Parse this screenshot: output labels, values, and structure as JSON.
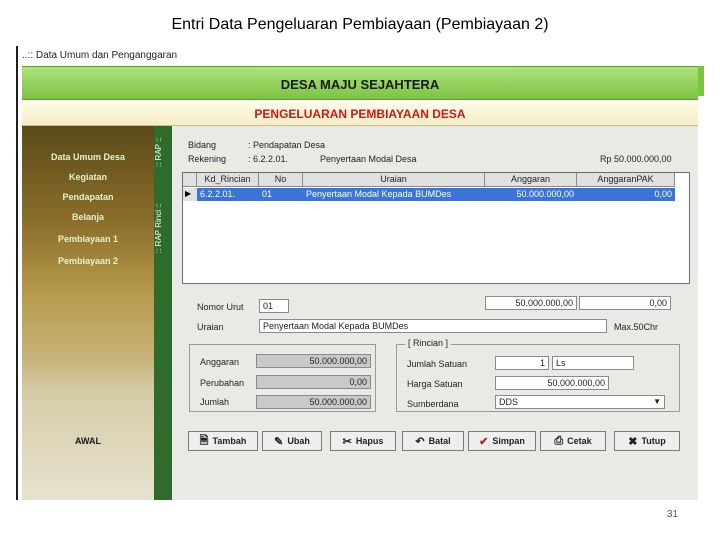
{
  "slide_title": "Entri Data Pengeluaran Pembiayaan (Pembiayaan 2)",
  "window_title": "..:: Data Umum dan Penganggaran",
  "header": {
    "village": "DESA MAJU SEJAHTERA",
    "section": "PENGELUARAN PEMBIAYAAN DESA"
  },
  "sidebar": {
    "items": [
      {
        "label": "Data Umum Desa"
      },
      {
        "label": "Kegiatan"
      },
      {
        "label": "Pendapatan"
      },
      {
        "label": "Belanja"
      },
      {
        "label": "Pembiayaan 1"
      },
      {
        "label": "Pembiayaan 2"
      }
    ],
    "awal": "AWAL"
  },
  "vtabs": {
    "rap": ":: RAP ::",
    "rap_rinci": ":: RAP Rinci ::"
  },
  "form": {
    "bidang_label": "Bidang",
    "bidang_value": ": Pendapatan Desa",
    "rekening_label": "Rekening",
    "rekening_value": ": 6.2.2.01.",
    "rekening_name": "Penyertaan Modal Desa",
    "rekening_total": "Rp 50.000.000,00"
  },
  "table": {
    "columns": [
      "Kd_Rincian",
      "No",
      "Uraian",
      "Anggaran",
      "AnggaranPAK"
    ],
    "rows": [
      {
        "kd": "6.2.2.01.",
        "no": "01",
        "uraian": "Penyertaan Modal Kepada BUMDes",
        "anggaran": "50.000.000,00",
        "pak": "0,00"
      }
    ]
  },
  "detail": {
    "nomor_urut_label": "Nomor Urut",
    "nomor_urut_value": "01",
    "total_anggaran": "50.000.000,00",
    "total_pak": "0,00",
    "uraian_label": "Uraian",
    "uraian_value": "Penyertaan Modal Kepada BUMDes",
    "max_hint": "Max.50Chr"
  },
  "summary": {
    "anggaran_label": "Anggaran",
    "anggaran_value": "50.000.000,00",
    "perubahan_label": "Perubahan",
    "perubahan_value": "0,00",
    "jumlah_label": "Jumlah",
    "jumlah_value": "50.000.000,00"
  },
  "rincian": {
    "legend": "[ Rincian ]",
    "jumlah_satuan_label": "Jumlah Satuan",
    "jumlah_satuan_value": "1",
    "satuan_value": "Ls",
    "harga_satuan_label": "Harga Satuan",
    "harga_satuan_value": "50.000.000,00",
    "sumberdana_label": "Sumberdana",
    "sumberdana_value": "DDS"
  },
  "buttons": {
    "tambah": "Tambah",
    "ubah": "Ubah",
    "hapus": "Hapus",
    "batal": "Batal",
    "simpan": "Simpan",
    "cetak": "Cetak",
    "tutup": "Tutup"
  },
  "page_number": "31"
}
